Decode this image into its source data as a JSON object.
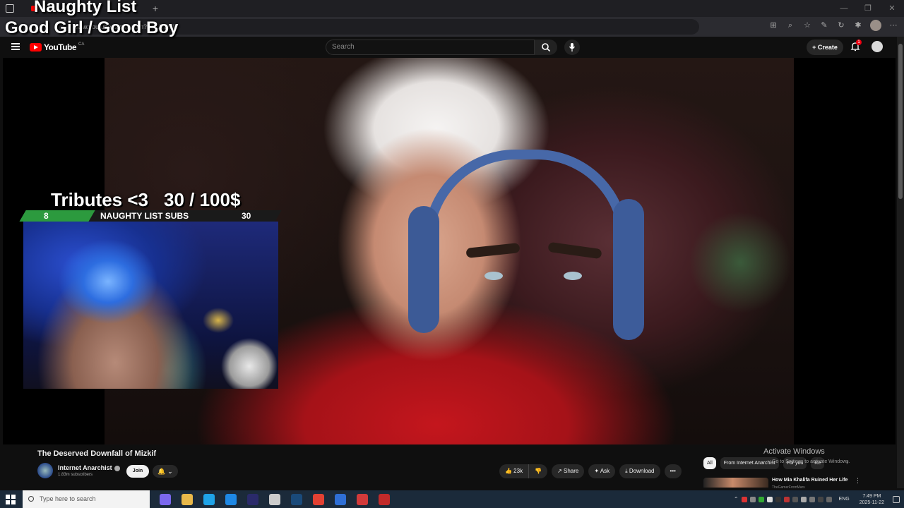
{
  "browser": {
    "tab_title": "",
    "new_tab": "+",
    "url": "www.youtube.com/watch?v=...NWJI",
    "window_controls": [
      "—",
      "❐",
      "✕"
    ]
  },
  "overlay": {
    "title": "Naughty List",
    "subtitle": "Good Girl / Good Boy",
    "tributes_label": "Tributes <3",
    "tributes_amount": "30 / 100$",
    "subs_left": "8",
    "subs_label": "NAUGHTY LIST SUBS",
    "subs_right": "30",
    "subs_progress": 0.27
  },
  "youtube": {
    "logo_text": "YouTube",
    "country": "CA",
    "search_placeholder": "Search",
    "create_label": "+ Create",
    "notif_count": "1"
  },
  "video": {
    "title": "The Deserved Downfall of Mizkif",
    "channel": "Internet Anarchist",
    "subscribers": "1.83m subscribers",
    "join_label": "Join",
    "bell_label": "🔔 ⌄"
  },
  "actions": {
    "like": "👍 23k",
    "dislike": "👎",
    "share": "↗ Share",
    "ask": "✦ Ask",
    "download": "⤓ Download",
    "more": "•••"
  },
  "chips": [
    "All",
    "From Internet Anarchist",
    "For you",
    "Re"
  ],
  "watermark": {
    "line1": "Activate Windows",
    "line2": "Go to Settings to activate Windows."
  },
  "recommendation": {
    "title": "How Mia Khalifa Ruined Her Life",
    "channel": "TheGamerFromMars"
  },
  "taskbar": {
    "search_placeholder": "Type here to search",
    "lang": "ENG",
    "time": "7:49 PM",
    "date": "2025-11-22",
    "app_colors": [
      "#7b68ee",
      "#e8b84a",
      "#1fa3e8",
      "#1e88e5",
      "#2a2a6a",
      "#cccccc",
      "#1a4a7a",
      "#e34133",
      "#2f6fd6",
      "#d23a3a",
      "#c12a2a"
    ]
  }
}
